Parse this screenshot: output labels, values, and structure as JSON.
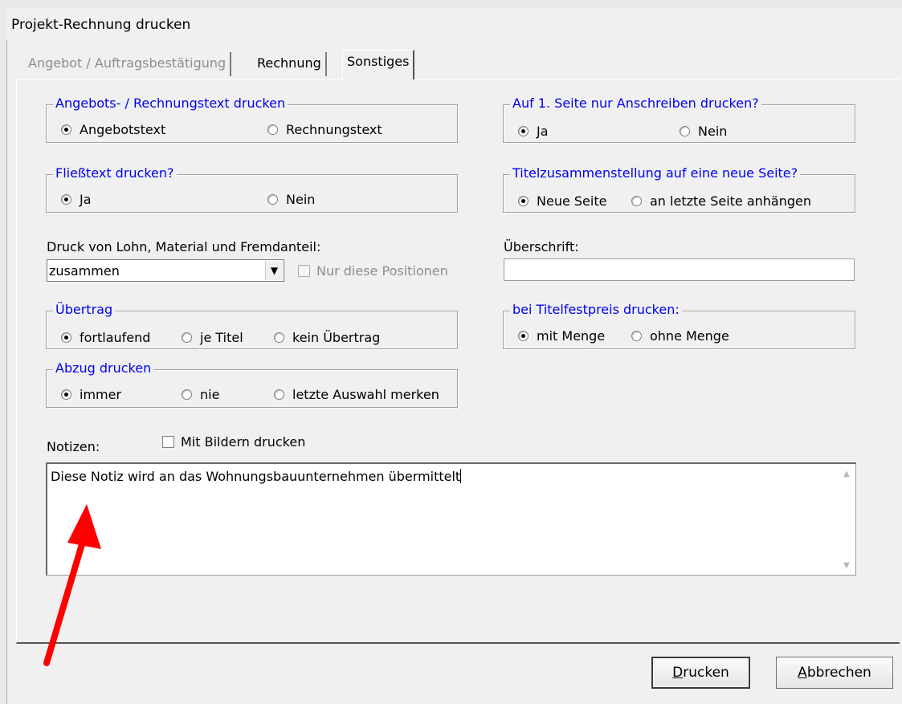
{
  "window": {
    "title": "Projekt-Rechnung drucken"
  },
  "tabs": [
    {
      "label": "Angebot / Auftragsbestätigung",
      "state": "disabled"
    },
    {
      "label": "Rechnung",
      "state": "normal"
    },
    {
      "label": "Sonstiges",
      "state": "active"
    }
  ],
  "groups": {
    "text_print": {
      "legend": "Angebots- / Rechnungstext drucken",
      "options": [
        "Angebotstext",
        "Rechnungstext"
      ],
      "selected": "Angebotstext"
    },
    "first_page": {
      "legend": "Auf 1. Seite nur Anschreiben drucken?",
      "options": [
        "Ja",
        "Nein"
      ],
      "selected": "Ja"
    },
    "flowtext": {
      "legend": "Fließtext drucken?",
      "options": [
        "Ja",
        "Nein"
      ],
      "selected": "Ja"
    },
    "title_summary": {
      "legend": "Titelzusammenstellung auf eine neue Seite?",
      "options": [
        "Neue Seite",
        "an letzte Seite anhängen"
      ],
      "selected": "Neue Seite"
    },
    "carryover": {
      "legend": "Übertrag",
      "options": [
        "fortlaufend",
        "je Titel",
        "kein Übertrag"
      ],
      "selected": "fortlaufend"
    },
    "fixed_price": {
      "legend": "bei Titelfestpreis drucken:",
      "options": [
        "mit Menge",
        "ohne Menge"
      ],
      "selected": "mit Menge"
    },
    "deduction": {
      "legend": "Abzug drucken",
      "options": [
        "immer",
        "nie",
        "letzte Auswahl merken"
      ],
      "selected": "immer"
    }
  },
  "print_mode": {
    "label": "Druck von Lohn, Material und Fremdanteil:",
    "value": "zusammen",
    "only_positions_label": "Nur diese Positionen",
    "only_positions_checked": false
  },
  "heading": {
    "label": "Überschrift:",
    "value": ""
  },
  "notes": {
    "label": "Notizen:",
    "with_images_label": "Mit Bildern drucken",
    "with_images_checked": false,
    "text": "Diese Notiz wird an das Wohnungsbauunternehmen übermittelt"
  },
  "buttons": {
    "print": "Drucken",
    "cancel": "Abbrechen"
  },
  "colors": {
    "legend": "#0000ee",
    "annotation_arrow": "#ff0000"
  },
  "icons": {
    "dropdown": "chevron-down-icon",
    "scroll_up": "scroll-up-icon",
    "scroll_down": "scroll-down-icon"
  }
}
